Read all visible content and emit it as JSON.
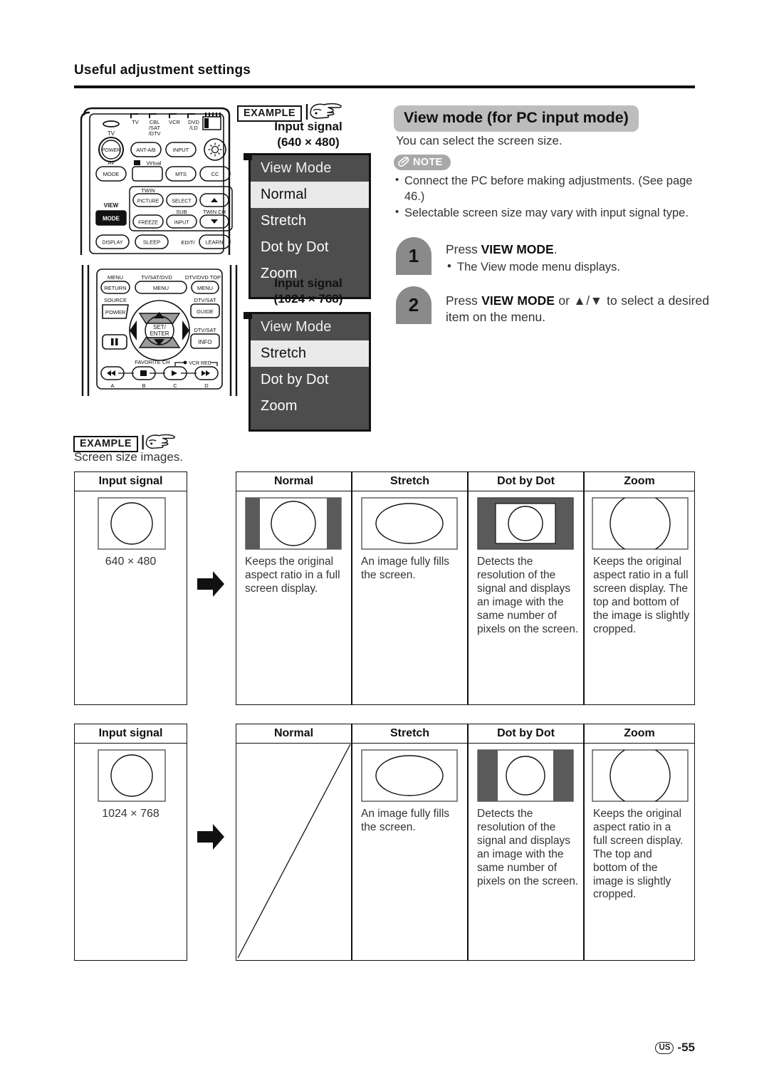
{
  "page": {
    "section_title": "Useful adjustment settings",
    "footer_region": "US",
    "footer_page": "-55"
  },
  "example_badges": {
    "label": "EXAMPLE",
    "hand_icon": "pointing-hand-icon"
  },
  "osd_examples": [
    {
      "signal_label_line1": "Input signal",
      "signal_label_line2": "(640 × 480)",
      "menu_header": "View Mode",
      "items": [
        "Normal",
        "Stretch",
        "Dot by Dot",
        "Zoom"
      ],
      "selected": "Normal"
    },
    {
      "signal_label_line1": "Input signal",
      "signal_label_line2": "(1024 × 768)",
      "menu_header": "View Mode",
      "items": [
        "Stretch",
        "Dot by Dot",
        "Zoom"
      ],
      "selected": "Stretch"
    }
  ],
  "remotes": {
    "remote1": {
      "labels_top": [
        "TV",
        "CBL/SAT/DTV",
        "VCR",
        "DVD/LD"
      ],
      "tv_label": "TV",
      "power": "POWER",
      "ant": "ANT-A/B",
      "input": "INPUT",
      "av_label": "AV",
      "mode": "MODE",
      "virtual": "Virtual",
      "mts": "MTS",
      "cc": "CC",
      "twin_label": "TWIN",
      "picture": "PICTURE",
      "select": "SELECT",
      "sub_label": "SUB",
      "twin_ch_label": "TWIN CH",
      "freeze": "FREEZE",
      "input2": "INPUT",
      "view_label": "VIEW",
      "view_mode_button": "MODE",
      "display": "DISPLAY",
      "sleep": "SLEEP",
      "edit_label": "EDIT/",
      "learn": "LEARN"
    },
    "remote2": {
      "menu_label": "MENU",
      "return_button": "RETURN",
      "tv_sat_dvd_label": "TV/SAT/DVD",
      "menu_button": "MENU",
      "dtv_dvd_top_label": "DTV/DVD TOP",
      "menu_button2": "MENU",
      "source_label": "SOURCE",
      "power_button": "POWER",
      "dtv_sat_label": "DTV/SAT",
      "guide_button": "GUIDE",
      "set_enter": "SET/\nENTER",
      "dtv_sat_label2": "DTV/SAT",
      "info_button": "INFO",
      "favorite_ch_label": "FAVORITE CH",
      "vcr_rec_label": "VCR REC",
      "abcd": [
        "A",
        "B",
        "C",
        "D"
      ]
    }
  },
  "right": {
    "title": "View mode (for PC input mode)",
    "lead": "You can select the screen size.",
    "note_label": "NOTE",
    "note_icon": "paperclip-icon",
    "notes": [
      "Connect the PC before making adjustments. (See page 46.)",
      "Selectable screen size may vary with input signal type."
    ],
    "steps": [
      {
        "number": "1",
        "text_prefix": "Press ",
        "text_bold": "VIEW MODE",
        "text_suffix": ".",
        "sub": "The View mode menu displays."
      },
      {
        "number": "2",
        "text_prefix": "Press ",
        "text_bold": "VIEW MODE",
        "text_mid": " or ▲/▼ to select a desired item on the menu.",
        "text_suffix": "",
        "sub": ""
      }
    ]
  },
  "screen_size_section": {
    "example_label": "EXAMPLE",
    "caption": "Screen size images."
  },
  "tables": [
    {
      "input_header": "Input signal",
      "input_dim": "640 × 480",
      "arrow_icon": "right-arrow-icon",
      "columns": [
        {
          "header": "Normal",
          "thumb": "pillarbox-circle",
          "desc": "Keeps the original aspect ratio in a full screen display."
        },
        {
          "header": "Stretch",
          "thumb": "full-ellipse",
          "desc": "An image fully fills the screen."
        },
        {
          "header": "Dot by Dot",
          "thumb": "inset-circle-dark",
          "desc": "Detects the resolution of the signal and displays an image with the same number of pixels on the screen."
        },
        {
          "header": "Zoom",
          "thumb": "cropped-circle",
          "desc": "Keeps the original aspect ratio in a full screen display. The top and bottom of the image is slightly cropped."
        }
      ]
    },
    {
      "input_header": "Input signal",
      "input_dim": "1024 × 768",
      "arrow_icon": "right-arrow-icon",
      "columns": [
        {
          "header": "Normal",
          "thumb": "not-available-diagonal",
          "desc": ""
        },
        {
          "header": "Stretch",
          "thumb": "full-ellipse",
          "desc": "An image fully fills the screen."
        },
        {
          "header": "Dot by Dot",
          "thumb": "pillarbox-circle-dark",
          "desc": "Detects the resolution of the signal and displays an image with the same number of pixels on the screen."
        },
        {
          "header": "Zoom",
          "thumb": "cropped-circle",
          "desc": "Keeps the original aspect ratio in a full screen display. The top and bottom of the image is slightly cropped."
        }
      ]
    }
  ],
  "colors": {
    "osd_bg": "#4d4d4d",
    "osd_selected_bg": "#e9e9e9",
    "title_pill_bg": "#bdbdbd",
    "note_pill_bg": "#a8a8a8",
    "step_badge_bg": "#8a8a8a",
    "thumb_mask": "#5a5a5a"
  }
}
